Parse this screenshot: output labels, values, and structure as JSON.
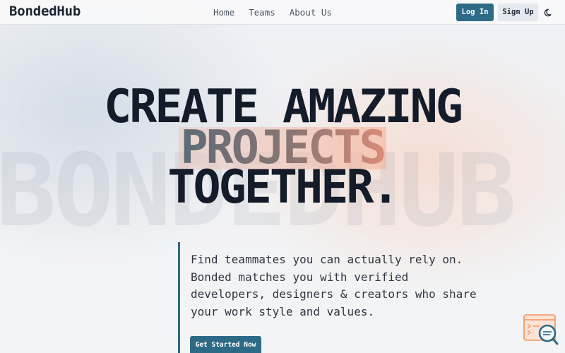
{
  "nav": {
    "brand": "BondedHub",
    "links": [
      "Home",
      "Teams",
      "About Us"
    ],
    "login_label": "Log In",
    "signup_label": "Sign Up",
    "theme_icon": "moon-icon"
  },
  "hero": {
    "watermark": "BONDEDHUB",
    "line1": "CREATE AMAZING",
    "highlight": "PROJECTS",
    "line3": "TOGETHER.",
    "tagline": [
      "Find teammates you can actually rely on.",
      "Bonded matches you with verified",
      "developers, designers & creators who share",
      "your work style and values."
    ],
    "cta_label": "Get Started Now"
  },
  "widget": {
    "icon": "search-document-icon"
  },
  "colors": {
    "accent": "#2d6a86",
    "text_dark": "#141c2a",
    "highlight_orange": "#f29a7a"
  }
}
